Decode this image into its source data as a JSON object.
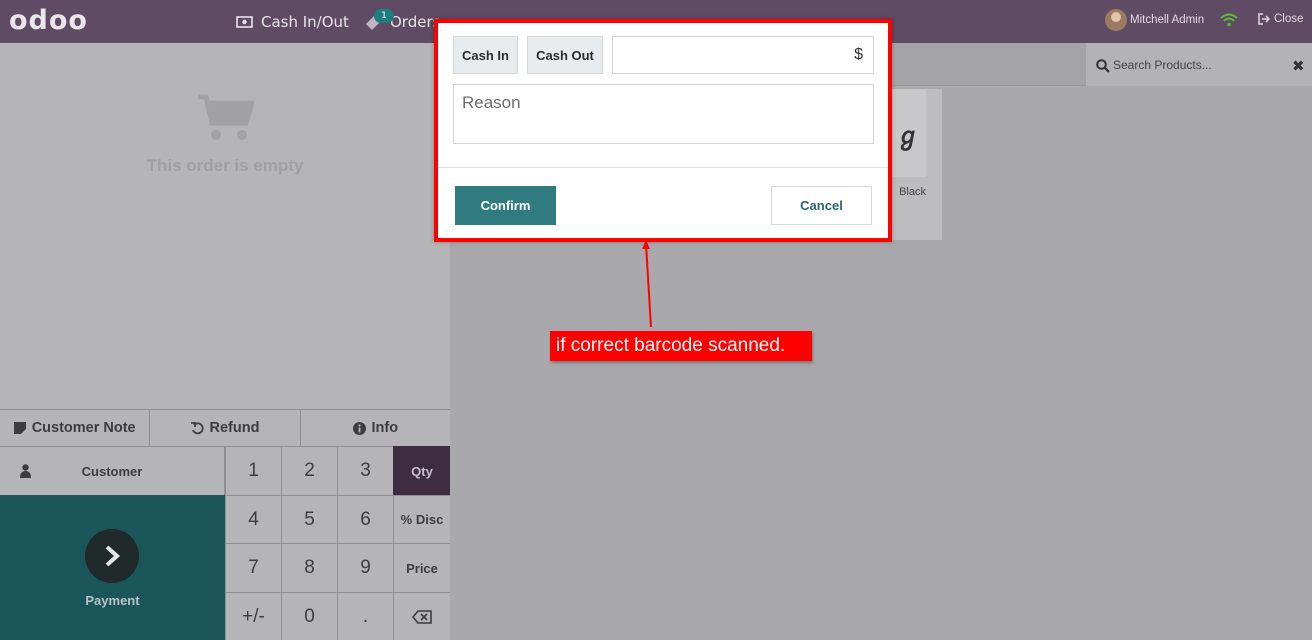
{
  "topbar": {
    "logo": "odoo",
    "cash_in_out_label": "Cash In/Out",
    "orders_label": "Orders",
    "orders_count": "1",
    "user_name": "Mitchell Admin",
    "close_label": "Close"
  },
  "order": {
    "empty_text": "This order is empty"
  },
  "controls": {
    "customer_note": "Customer Note",
    "refund": "Refund",
    "info": "Info"
  },
  "customer_label": "Customer",
  "payment_label": "Payment",
  "numpad": {
    "keys": [
      "1",
      "2",
      "3",
      "Qty",
      "4",
      "5",
      "6",
      "% Disc",
      "7",
      "8",
      "9",
      "Price",
      "+/-",
      "0",
      "."
    ],
    "active_mode": "Qty"
  },
  "search": {
    "placeholder": "Search Products..."
  },
  "product": {
    "name_fragment": "Black"
  },
  "modal": {
    "cash_in_label": "Cash In",
    "cash_out_label": "Cash Out",
    "amount_value": "",
    "currency_symbol": "$",
    "reason_placeholder": "Reason",
    "confirm_label": "Confirm",
    "cancel_label": "Cancel"
  },
  "annotation": {
    "text": "if correct barcode scanned."
  },
  "colors": {
    "topbar": "#5f4b63",
    "teal": "#2f7b7f",
    "highlight_red": "#ff0000"
  },
  "icons": [
    "cash-icon",
    "ticket-icon",
    "wifi-icon",
    "sign-out-icon",
    "shopping-cart-icon",
    "sticky-note-icon",
    "undo-icon",
    "info-circle-icon",
    "user-icon",
    "chevron-right-icon",
    "backspace-icon",
    "search-icon",
    "close-icon"
  ]
}
